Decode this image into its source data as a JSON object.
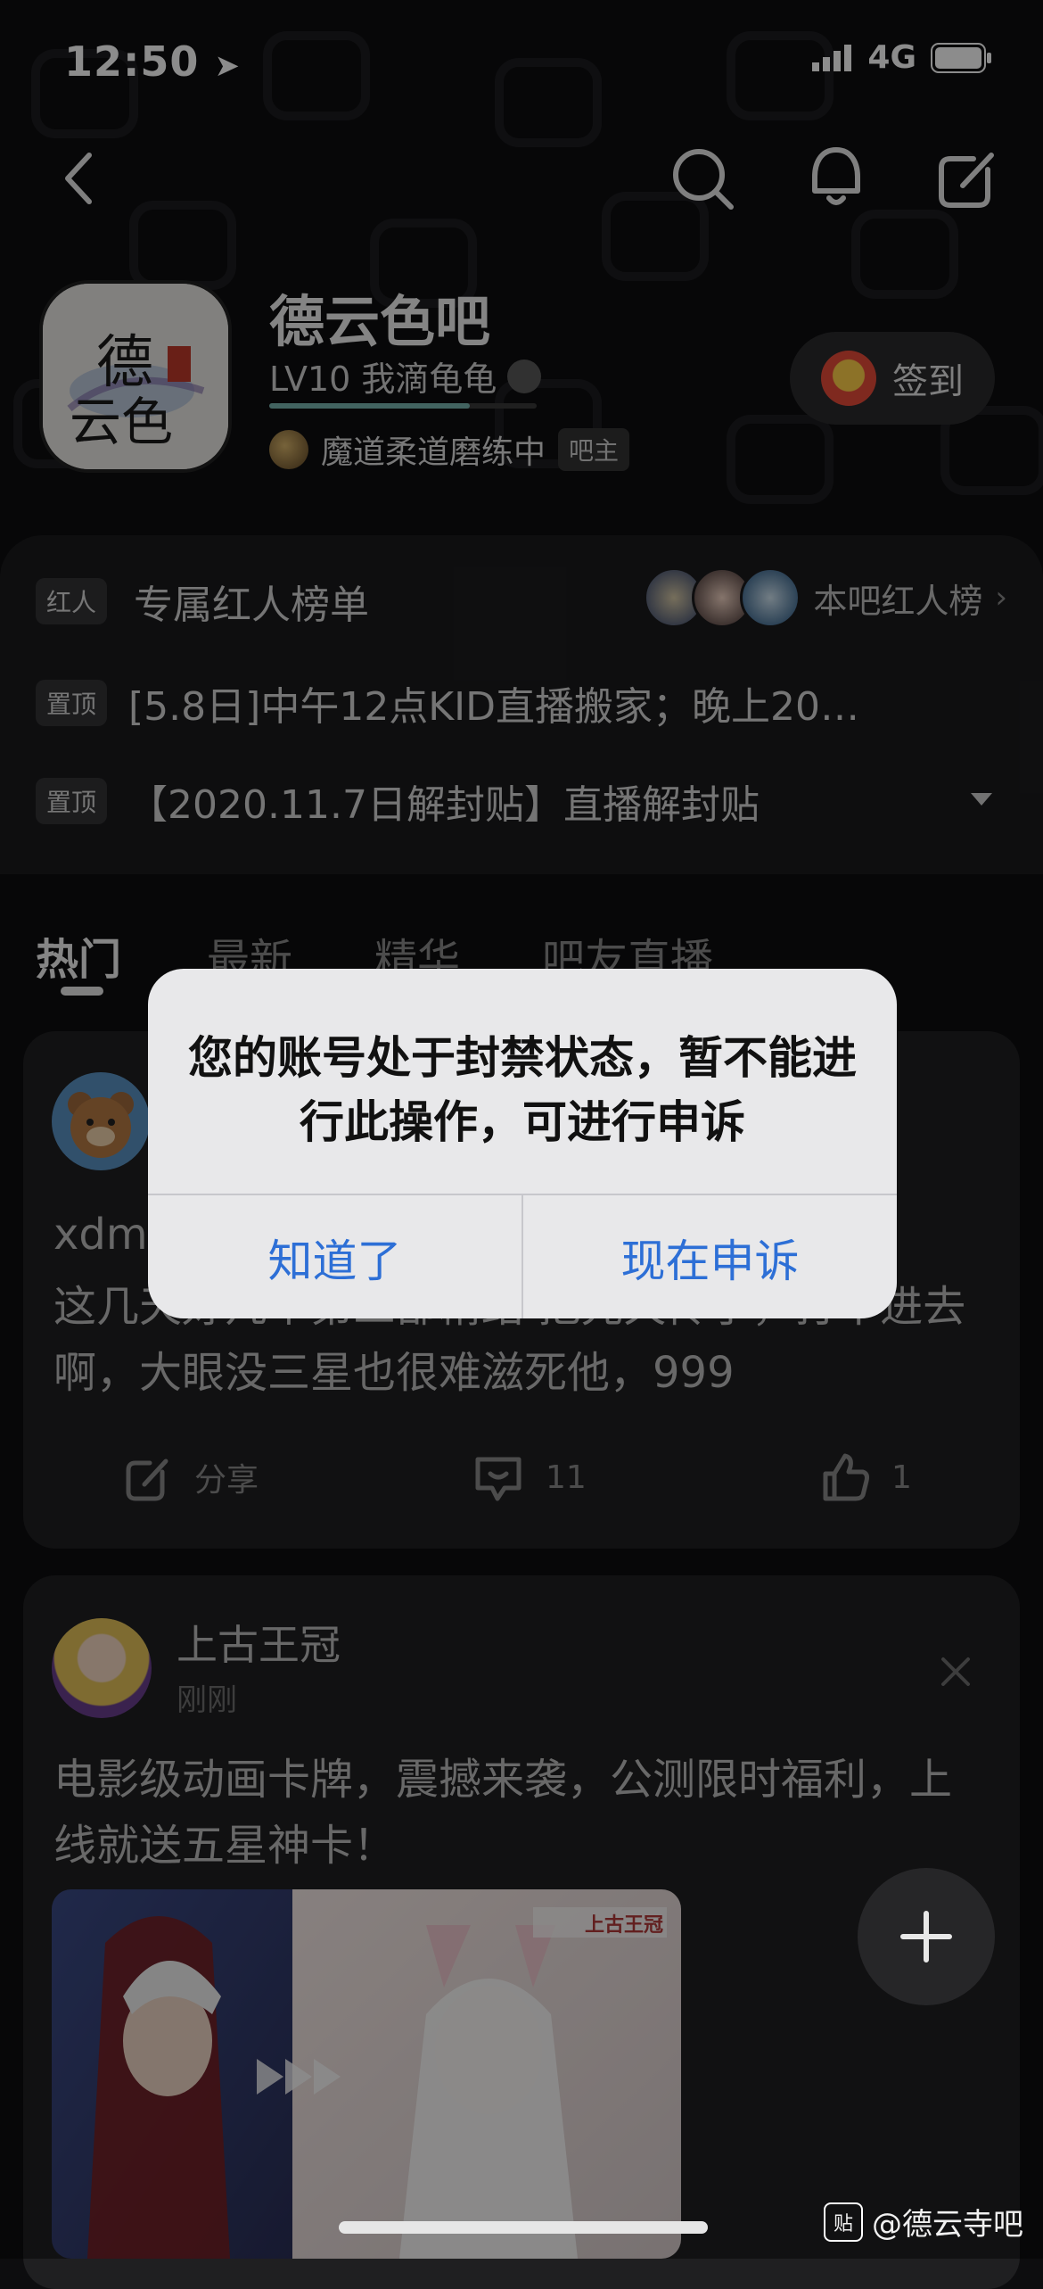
{
  "status_bar": {
    "time": "12:50",
    "network": "4G"
  },
  "forum": {
    "name": "德云色吧",
    "level": "LV10 我滴龟龟",
    "level_progress": 0.75,
    "owner_name": "魔道柔道磨练中",
    "owner_badge": "吧主",
    "signin_label": "签到",
    "logo_text": "德云色"
  },
  "notices": {
    "red_tag": "红人",
    "red_title": "专属红人榜单",
    "red_link": "本吧红人榜",
    "pinned_tag": "置顶",
    "pinned_1": "[5.8日]中午12点KID直播搬家；晚上20…",
    "pinned_2": "【2020.11.7日解封贴】直播解封贴"
  },
  "tabs": [
    "热门",
    "最新",
    "精华",
    "吧友直播"
  ],
  "post1": {
    "title_partial": "xdm",
    "body": "这几天好几个第三部精结 把先天传子，打不进去啊，大眼没三星也很难滋死他，999",
    "share_label": "分享",
    "comment_count": "11",
    "like_count": "1"
  },
  "ad": {
    "author": "上古王冠",
    "time": "刚刚",
    "body": "电影级动画卡牌，震撼来袭，公测限时福利，上线就送五星神卡！",
    "image_caption": "上古王冠"
  },
  "dialog": {
    "message": "您的账号处于封禁状态，暂不能进行此操作，可进行申诉",
    "ok_label": "知道了",
    "appeal_label": "现在申诉"
  },
  "watermark": {
    "logo": "贴",
    "text": "@德云寺吧"
  }
}
